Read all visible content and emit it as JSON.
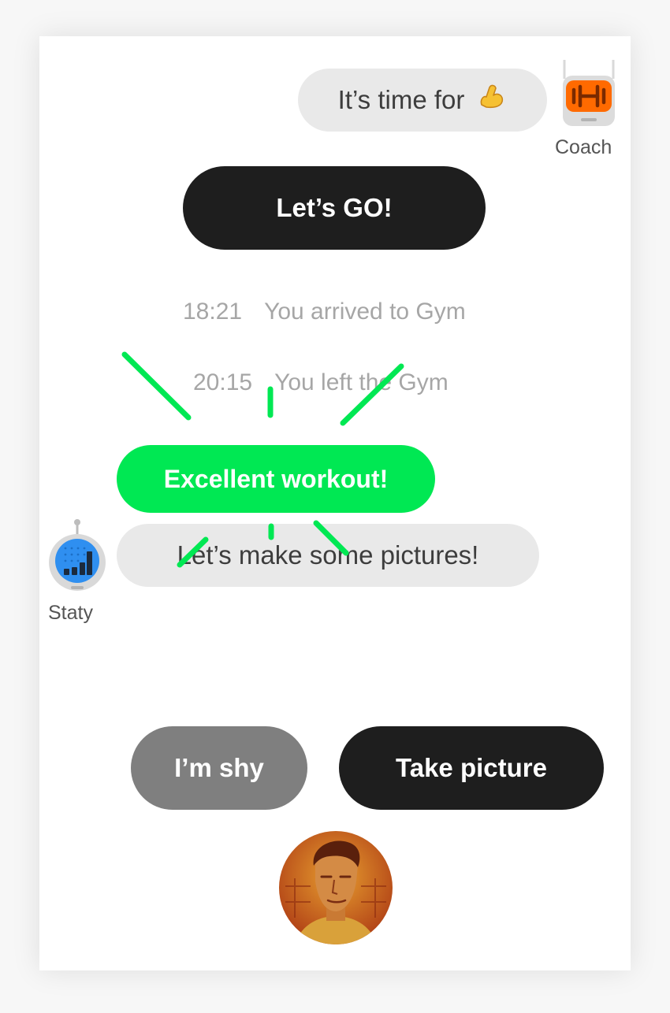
{
  "coach": {
    "label": "Coach",
    "message": "It’s time for",
    "emoji": "💪",
    "icon": "dumbbell-icon",
    "accent": "#ff6a00"
  },
  "actions": {
    "lets_go": "Let’s GO!",
    "shy": "I’m shy",
    "take_picture": "Take picture"
  },
  "events": [
    {
      "time": "18:21",
      "text": "You arrived to Gym"
    },
    {
      "time": "20:15",
      "text": "You left the Gym"
    }
  ],
  "badge": {
    "text": "Excellent workout!",
    "color": "#00e853"
  },
  "staty": {
    "label": "Staty",
    "message": "Let’s make some pictures!",
    "icon": "bar-chart-icon",
    "accent": "#2f8ff0"
  },
  "user_avatar": {
    "icon": "user-photo"
  },
  "colors": {
    "dark_button": "#1e1e1e",
    "grey_button": "#7f7f7f",
    "bubble": "#e9e9e9"
  }
}
